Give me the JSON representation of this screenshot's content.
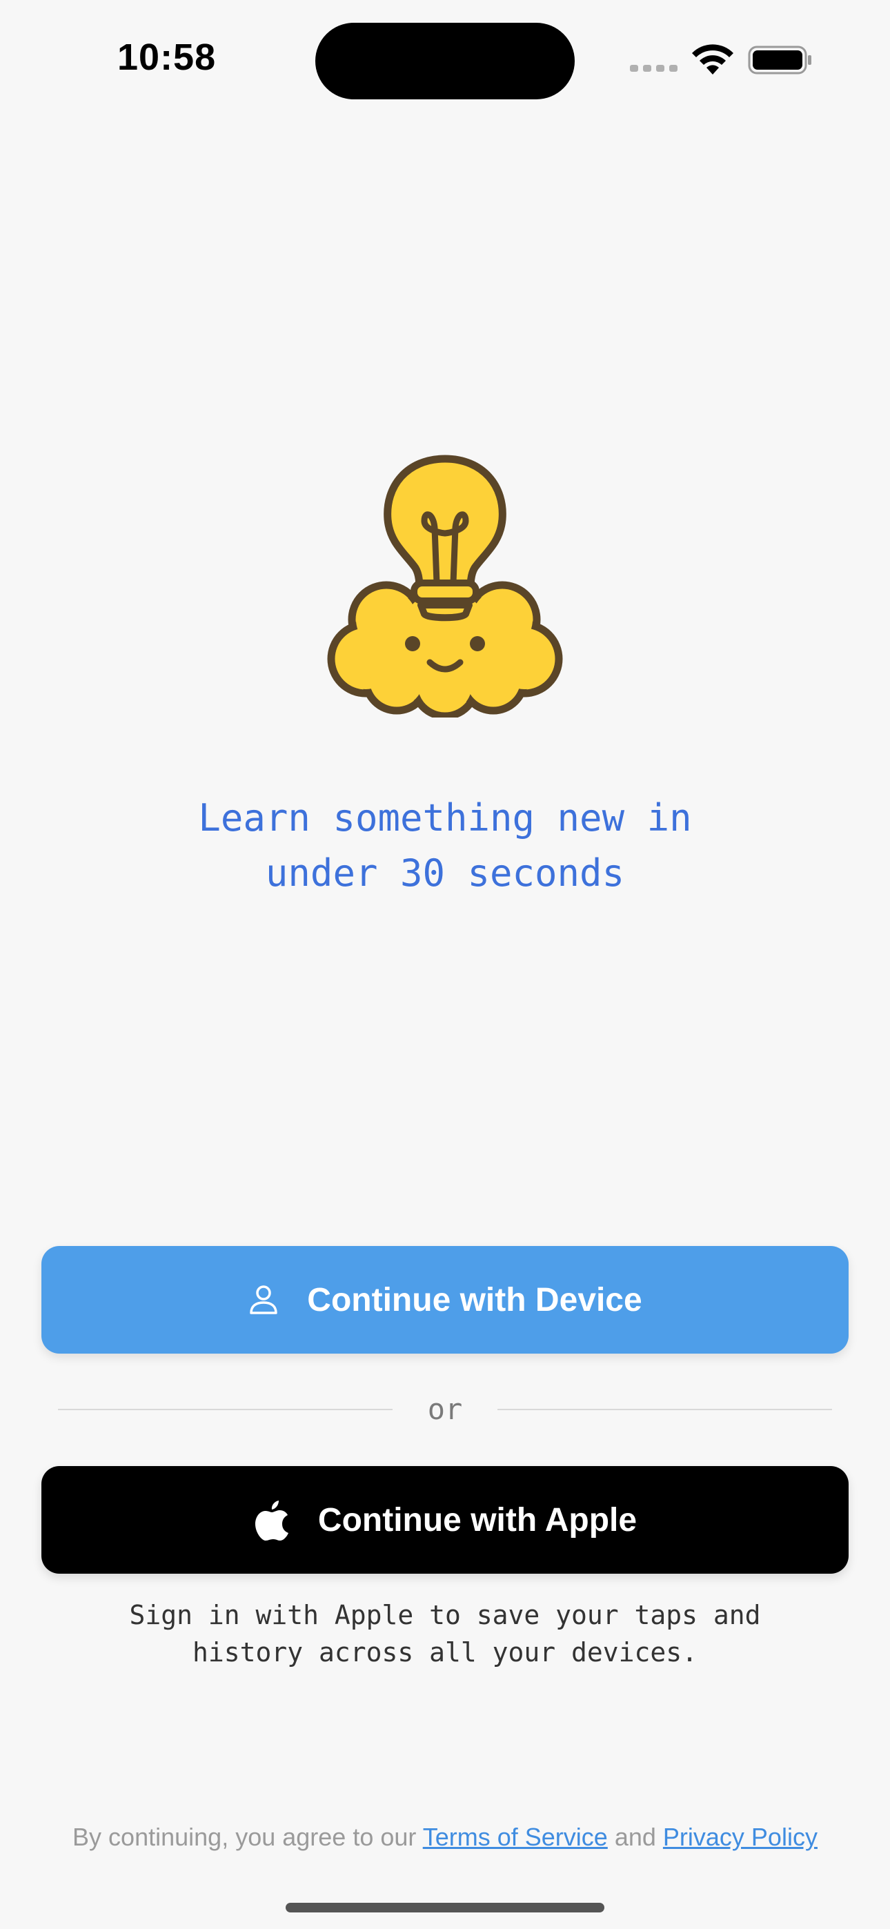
{
  "status_bar": {
    "time": "10:58"
  },
  "tagline": {
    "line1": "Learn something new in",
    "line2": "under 30 seconds"
  },
  "buttons": {
    "device_label": "Continue with Device",
    "device_icon": "person-icon",
    "apple_label": "Continue with Apple",
    "apple_icon": "apple-logo-icon"
  },
  "divider": {
    "text": "or"
  },
  "hint": {
    "line1": "Sign in with Apple to save your taps and",
    "line2": "history across all your devices."
  },
  "legal": {
    "prefix": "By continuing, you agree to our ",
    "terms_link": "Terms of Service",
    "middle": " and ",
    "privacy_link": "Privacy Policy"
  },
  "colors": {
    "background": "#f7f7f7",
    "accent_blue": "#4e9ee9",
    "tagline_blue": "#3d71db",
    "apple_button": "#000000",
    "mascot_yellow": "#fdd138",
    "mascot_outline": "#5a4528"
  }
}
